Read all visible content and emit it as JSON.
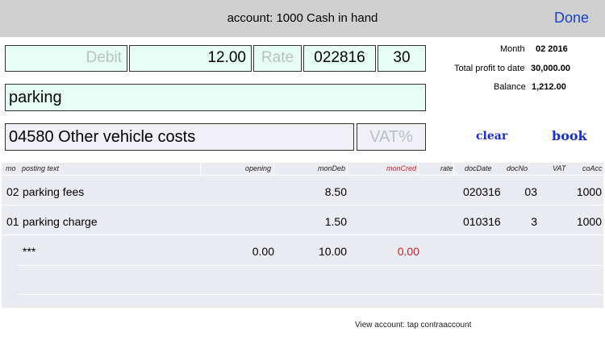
{
  "header": {
    "title": "account:  1000 Cash in hand",
    "done_label": "Done"
  },
  "entry": {
    "debit_placeholder": "Debit",
    "amount": "12.00",
    "rate_placeholder": "Rate",
    "date": "022816",
    "day": "30",
    "posting_text": "parking",
    "contra_account": "04580 Other vehicle costs",
    "vat_placeholder": "VAT%"
  },
  "info": {
    "month_label": "Month",
    "month_value": "02  2016",
    "profit_label": "Total profit to date",
    "profit_value": "30,000.00",
    "balance_label": "Balance",
    "balance_value": "1,212.00"
  },
  "actions": {
    "clear_label": "clear",
    "book_label": "book"
  },
  "table": {
    "headers": [
      "mo",
      "posting text",
      "opening",
      "monDeb",
      "monCred",
      "rate",
      "docDate",
      "docNo",
      "VAT",
      "coAcc"
    ],
    "rows": [
      {
        "mo": "02",
        "text": "parking fees",
        "opening": "",
        "monDeb": "8.50",
        "monCred": "",
        "rate": "",
        "docDate": "020316",
        "docNo": "03",
        "vat": "",
        "coAcc": "1000"
      },
      {
        "mo": "01",
        "text": "parking charge",
        "opening": "",
        "monDeb": "1.50",
        "monCred": "",
        "rate": "",
        "docDate": "010316",
        "docNo": "3",
        "vat": "",
        "coAcc": "1000"
      }
    ],
    "totals": {
      "text": "***",
      "opening": "0.00",
      "monDeb": "10.00",
      "monCred": "0.00"
    }
  },
  "footer": {
    "hint": "View account: tap contraaccount"
  },
  "colors": {
    "accent": "#1a3fd0",
    "red": "#d0202a",
    "mint": "#e6fff6",
    "lavender": "#f1f0f6"
  }
}
